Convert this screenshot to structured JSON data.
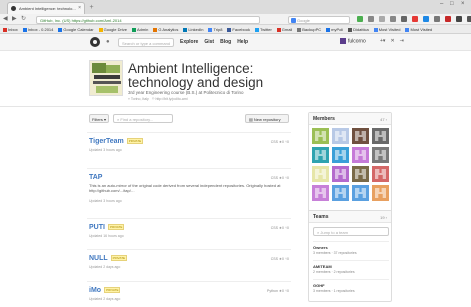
{
  "browser": {
    "tab_title": "Ambient Intelligence: technolo...",
    "url": "GitHub, Inc. (US) https://github.com/AmI-2014",
    "search_placeholder": "Google",
    "bookmarks": [
      {
        "label": "Inbox",
        "color": "#d93025"
      },
      {
        "label": "Inbox - 0.2014",
        "color": "#1a73e8"
      },
      {
        "label": "Google Calendar",
        "color": "#1a73e8"
      },
      {
        "label": "Google Drive",
        "color": "#f4b400"
      },
      {
        "label": "Admin",
        "color": "#0f9d58"
      },
      {
        "label": "G Analytics",
        "color": "#e37400"
      },
      {
        "label": "LinkedIn",
        "color": "#0077b5"
      },
      {
        "label": "Trip8",
        "color": "#4285f4"
      },
      {
        "label": "Facebook",
        "color": "#3b5998"
      },
      {
        "label": "Twitter",
        "color": "#1da1f2"
      },
      {
        "label": "Gmail",
        "color": "#d93025"
      },
      {
        "label": "BackupPC",
        "color": "#777777"
      },
      {
        "label": "myPoli",
        "color": "#1a73e8"
      },
      {
        "label": "Didattica",
        "color": "#555555"
      },
      {
        "label": "Most Visited",
        "color": "#4285f4"
      },
      {
        "label": "Most Visited",
        "color": "#4285f4"
      }
    ]
  },
  "gh": {
    "search_placeholder": "Search or type a command",
    "nav": [
      "Explore",
      "Gist",
      "Blog",
      "Help"
    ],
    "user": "fulcorno"
  },
  "org": {
    "title": "Ambient Intelligence: technology and design",
    "subtitle": "3rd year Engineering course (B.S.) at Politecnico di Torino",
    "location": "Torino, Italy",
    "url": "http://bit.ly/polito-ami"
  },
  "filters": {
    "filter_label": "Filters",
    "find_placeholder": "Find a repository...",
    "new_repo_label": "New repository"
  },
  "repos": [
    {
      "name": "TigerTeam",
      "badge": "PRIVATE",
      "stats": "CSS  ★0  ⑂0",
      "updated": "Updated 3 hours ago",
      "desc": ""
    },
    {
      "name": "TAP",
      "badge": "",
      "stats": "CSS  ★0  ⑂0",
      "updated": "Updated 3 hours ago",
      "desc": "This is an auto-mirror of the original code derived from several independent repositories. Originally hosted at http://github.com/.../tap/…"
    },
    {
      "name": "PUTI",
      "badge": "PRIVATE",
      "stats": "CSS  ★0  ⑂0",
      "updated": "Updated 16 hours ago",
      "desc": ""
    },
    {
      "name": "NULL",
      "badge": "PRIVATE",
      "stats": "CSS  ★0  ⑂0",
      "updated": "Updated 2 days ago",
      "desc": ""
    },
    {
      "name": "iMo",
      "badge": "PRIVATE",
      "stats": "Python  ★0  ⑂0",
      "updated": "Updated 2 days ago",
      "desc": ""
    }
  ],
  "members": {
    "title": "Members",
    "count": "47 ›",
    "invite_placeholder": "Find a member by username",
    "avatars": [
      "#9bbf55",
      "#b8c9e6",
      "#6f5040",
      "#6a6a6a",
      "#2fa3b0",
      "#3aa0d8",
      "#c67ad8",
      "#7a7a7a",
      "#e6e6a8",
      "#b46acd",
      "#7a6a48",
      "#d46868",
      "#c780d8",
      "#5aa0e0",
      "#5aa0e0",
      "#e8a060"
    ]
  },
  "teams": {
    "title": "Teams",
    "count": "19 ›",
    "find_placeholder": "Jump to a team",
    "items": [
      {
        "name": "Owners",
        "meta": "3 members · 37 repositories"
      },
      {
        "name": "AMITEAM",
        "meta": "2 members · 2 repositories"
      },
      {
        "name": "GGHF",
        "meta": "3 members · 1 repositories"
      }
    ]
  }
}
